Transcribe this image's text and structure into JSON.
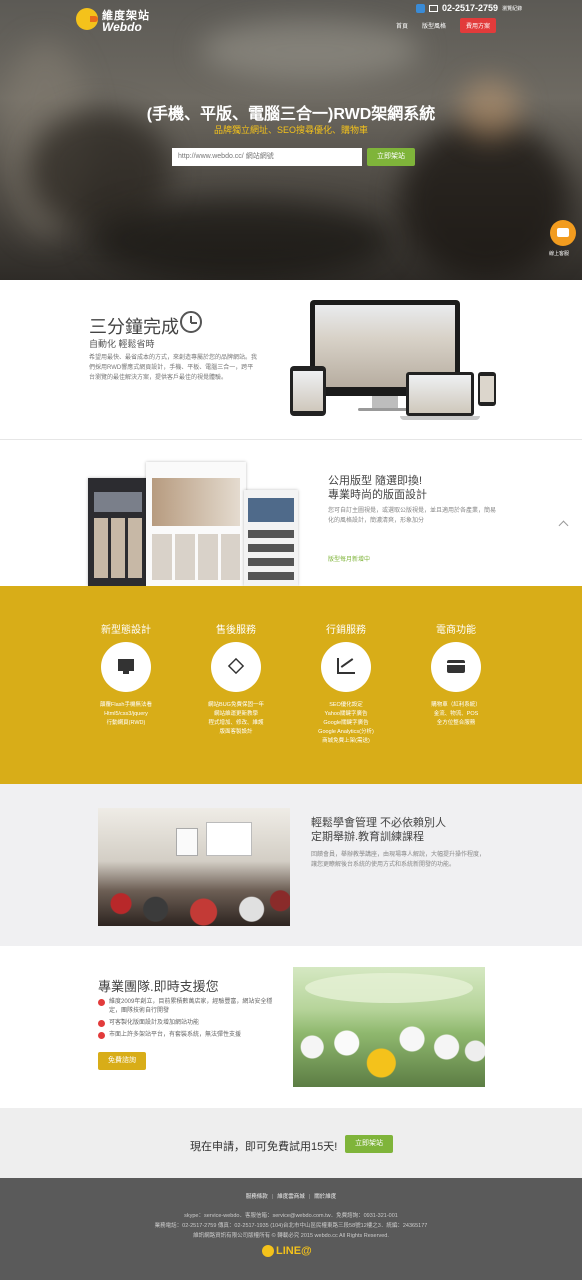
{
  "header": {
    "logo_cn": "維度架站",
    "logo_en": "Webdo",
    "phone": "02-2517-2759",
    "phone_note": "瀏覽紀錄",
    "nav": [
      "首頁",
      "版型風格"
    ],
    "nav_cta": "費用方案"
  },
  "hero": {
    "title": "(手機、平版、電腦三合一)RWD架網系統",
    "subtitle": "品牌獨立網址、SEO搜尋優化、購物車",
    "search_placeholder": "http://www.webdo.cc/ 網站網號",
    "button": "立即架站",
    "chat_label": "線上客服"
  },
  "section1": {
    "heading": "三分鐘完成",
    "subheading": "自動化 輕鬆省時",
    "text": "希望用最快、最省成本的方式，來創造專屬於您的品牌網站。我們採用RWD響應式網頁設計，手機、平板、電腦三合一，跨平台瀏覽的最佳解決方案，提供客戶最佳的視覺體驗。"
  },
  "section2": {
    "heading_l1": "公用版型 隨選即換!",
    "heading_l2": "專業時尚的版面設計",
    "text": "您可自訂主圖視覺，或選取公版視覺，並且適用於各產業，簡易化的風格設計，簡濃清爽，形象加分",
    "link": "版型每月新增中"
  },
  "features": [
    {
      "title": "新型態設計",
      "icon": "monitor-icon",
      "lines": [
        "顛覆Flash手機無法看",
        "Html5/css3/jquery",
        "行動網頁(RWD)"
      ]
    },
    {
      "title": "售後服務",
      "icon": "diamond-icon",
      "lines": [
        "網站BUG免費保固一年",
        "網站維運更新教學",
        "程式增加、修改、維護",
        "版面客製設計"
      ]
    },
    {
      "title": "行銷服務",
      "icon": "chart-icon",
      "lines": [
        "SEO優化設定",
        "Yahoo關鍵字廣告",
        "Google關鍵字廣告",
        "Google Analytics(分析)",
        "商城免費上架(需送)"
      ]
    },
    {
      "title": "電商功能",
      "icon": "card-icon",
      "lines": [
        "購物車（紅利系統）",
        "金流、物流、POS",
        "全方位整合服務"
      ]
    }
  ],
  "section4": {
    "heading_l1": "輕鬆學會管理 不必依賴別人",
    "heading_l2": "定期舉辦.教育訓練課程",
    "text": "回饋會員，舉辦教學講座，由現場專人解說，大幅提升操作程度，讓您更瞭解後台系統的使用方式和系統新開發的功能。"
  },
  "section5": {
    "heading": "專業團隊.即時支援您",
    "items": [
      "維度2009年創立，目前累積數萬店家，經驗豐富，網站安全穩定，團隊技術自行開發",
      "可客製化版面設計及增加網站功能",
      "市面上許多架站平台，有套裝系統，無法彈性支援"
    ],
    "button": "免費諮詢"
  },
  "cta": {
    "text": "現在申請，即可免費試用15天!",
    "button": "立即架站"
  },
  "footer": {
    "links": [
      "服務條款",
      "維度雲商城",
      "關於維度"
    ],
    "line1": "skype：service-webdo．客服信箱：service@webdo.com.tw．免費諮詢：0931-321-001",
    "line2": "業務電話：02-2517-2759 傳真：02-2517-1935 (104)台北市中山區民權東路三段58號12樓之3．統編：24365177",
    "line3": "維訊網路資訊有限公司版權所有 © 轉載必究 2015 webdo.cc All Rights Reserved.",
    "line_logo": "LINE@"
  },
  "colors": {
    "accent_yellow": "#d8ad18",
    "accent_green": "#7fb43a",
    "accent_red": "#e23b3b",
    "footer_bg": "#5a5a5a"
  }
}
